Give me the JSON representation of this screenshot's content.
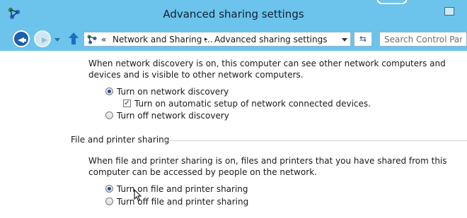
{
  "window": {
    "title": "Advanced sharing settings"
  },
  "navigation": {
    "breadcrumb": {
      "overflow": "«",
      "segment_1": "Network and Sharing ...",
      "separator": "▸",
      "segment_2": "Advanced sharing settings"
    },
    "search": {
      "placeholder": "Search Control Panel"
    }
  },
  "network_discovery": {
    "description": "When network discovery is on, this computer can see other network computers and devices and is visible to other network computers.",
    "options": [
      {
        "label": "Turn on network discovery",
        "selected": true
      },
      {
        "label": "Turn off network discovery",
        "selected": false
      }
    ],
    "auto_setup": {
      "label": "Turn on automatic setup of network connected devices.",
      "checked": true
    }
  },
  "file_printer_sharing": {
    "title": "File and printer sharing",
    "description": "When file and printer sharing is on, files and printers that you have shared from this computer can be accessed by people on the network.",
    "options": [
      {
        "label": "Turn on file and printer sharing",
        "selected": true
      },
      {
        "label": "Turn off file and printer sharing",
        "selected": false
      }
    ]
  }
}
